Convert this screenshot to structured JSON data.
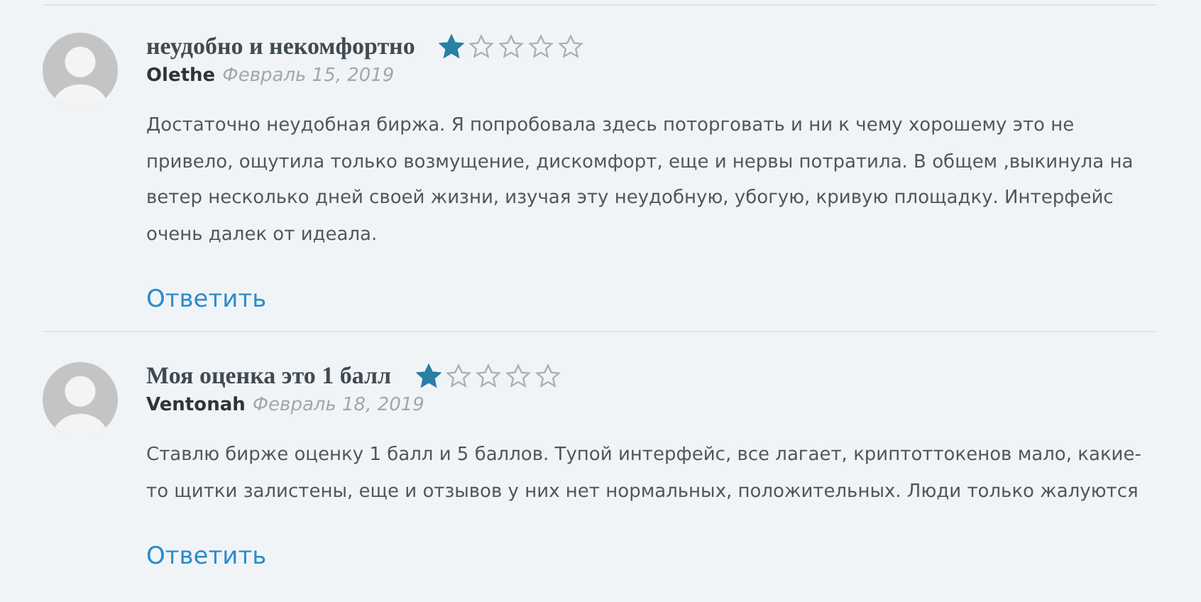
{
  "reviews": [
    {
      "title": "неудобно и некомфортно",
      "stars": 1,
      "author": "Olethe",
      "date": "Февраль 15, 2019",
      "text": "Достаточно неудобная биржа. Я попробовала здесь поторговать и ни к чему хорошему это не привело, ощутила только возмущение, дискомфорт, еще и нервы потратила. В общем ,выкинула на ветер несколько дней своей жизни, изучая эту неудобную, убогую, кривую площадку. Интерфейс очень далек от идеала.",
      "reply": "Ответить"
    },
    {
      "title": "Моя оценка это 1 балл",
      "stars": 1,
      "author": "Ventonah",
      "date": "Февраль 18, 2019",
      "text": "Ставлю бирже оценку 1 балл и 5 баллов. Тупой интерфейс, все лагает, криптоттокенов мало, какие-то щитки залистены, еще и отзывов у них нет нормальных, положительных. Люди только жалуются",
      "reply": "Ответить"
    }
  ]
}
